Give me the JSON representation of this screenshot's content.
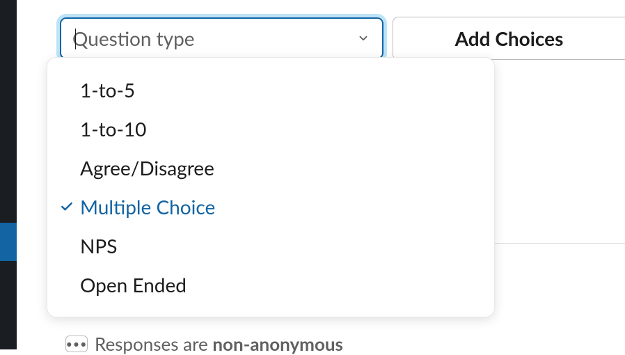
{
  "select": {
    "placeholder": "Question type",
    "selected_value": "Multiple Choice",
    "options": [
      {
        "label": "1-to-5",
        "selected": false
      },
      {
        "label": "1-to-10",
        "selected": false
      },
      {
        "label": "Agree/Disagree",
        "selected": false
      },
      {
        "label": "Multiple Choice",
        "selected": true
      },
      {
        "label": "NPS",
        "selected": false
      },
      {
        "label": "Open Ended",
        "selected": false
      }
    ]
  },
  "buttons": {
    "add_choices": "Add Choices"
  },
  "footer": {
    "prefix": "Responses are ",
    "strong": "non-anonymous"
  }
}
